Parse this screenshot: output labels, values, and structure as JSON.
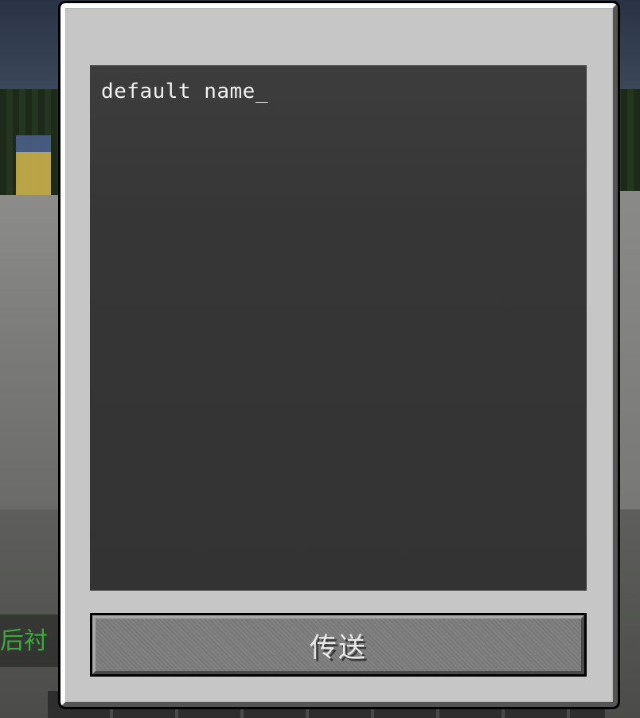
{
  "background": {
    "chat_text": "后衬"
  },
  "dialog": {
    "text_value": "default name",
    "cursor": "_",
    "send_label": "传送"
  },
  "colors": {
    "panel": "#c6c6c6",
    "text_area": "#363636",
    "button": "#7d7d7d",
    "text": "#f2f2f2",
    "chat_green": "#3ea83e"
  }
}
